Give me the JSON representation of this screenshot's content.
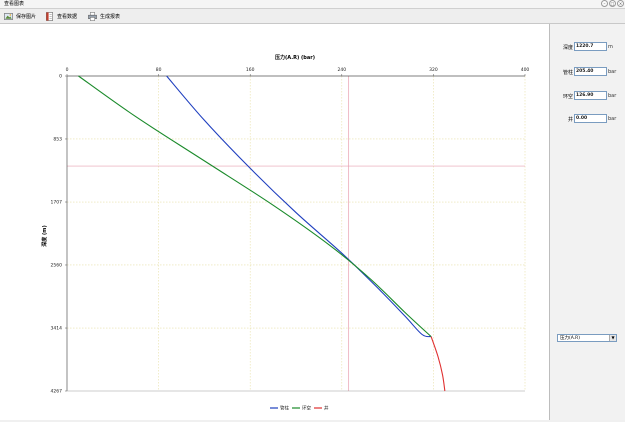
{
  "window": {
    "title": "查看图表"
  },
  "toolbar": {
    "save_image_label": "保存图片",
    "view_data_label": "查看数据",
    "generate_report_label": "生成报表"
  },
  "chart_data": {
    "type": "line",
    "title": "压力(A.R) (bar)",
    "xlabel": "压力(A.R) (bar)",
    "ylabel": "深度 (m)",
    "x_axis_position": "top",
    "y_inverted": true,
    "xlim": [
      0,
      400
    ],
    "ylim": [
      0,
      4267
    ],
    "x_ticks": [
      "0",
      "80",
      "160",
      "240",
      "320",
      "400"
    ],
    "y_ticks": [
      "0",
      "853",
      "1707",
      "2560",
      "3414",
      "4267"
    ],
    "grid": true,
    "legend_position": "bottom",
    "series": [
      {
        "name": "管柱",
        "color": "#1f3fbf",
        "x": [
          87,
          120,
          160,
          200,
          240,
          270,
          295,
          310,
          318
        ],
        "y": [
          0,
          600,
          1250,
          1850,
          2400,
          2850,
          3250,
          3500,
          3530
        ]
      },
      {
        "name": "环空",
        "color": "#1a8a2a",
        "x": [
          10,
          60,
          120,
          180,
          230,
          265,
          295,
          318
        ],
        "y": [
          0,
          550,
          1150,
          1750,
          2300,
          2750,
          3200,
          3530
        ]
      },
      {
        "name": "井",
        "color": "#e03030",
        "x": [
          318,
          324,
          328,
          330
        ],
        "y": [
          3530,
          3800,
          4050,
          4267
        ]
      }
    ],
    "markers": {
      "vertical_x": 246,
      "horizontal_y": 1220,
      "color": "#e8a0b0"
    }
  },
  "side_panel": {
    "fields": [
      {
        "label": "深度",
        "value": "1220.7",
        "unit": "m"
      },
      {
        "label": "管柱",
        "value": "205.40",
        "unit": "bar"
      },
      {
        "label": "环空",
        "value": "126.90",
        "unit": "bar"
      },
      {
        "label": "井",
        "value": "0.00",
        "unit": "bar"
      }
    ],
    "select_value": "压力(A.R)"
  }
}
